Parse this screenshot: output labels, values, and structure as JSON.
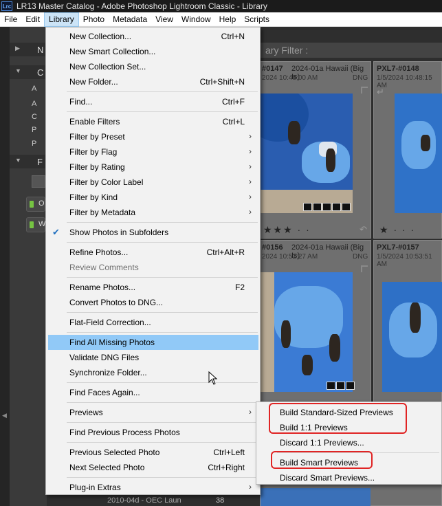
{
  "window": {
    "app_icon": "Lrc",
    "title": "LR13 Master Catalog - Adobe Photoshop Lightroom Classic - Library"
  },
  "menubar": [
    "File",
    "Edit",
    "Library",
    "Photo",
    "Metadata",
    "View",
    "Window",
    "Help",
    "Scripts"
  ],
  "active_menu": "Library",
  "left_panel": {
    "rows": [
      {
        "letter": "N",
        "expanded": false
      },
      {
        "letter": "C",
        "expanded": true
      },
      {
        "letter": "F",
        "expanded": true
      }
    ],
    "collection_letters": [
      "A",
      "A",
      "C",
      "P",
      "P"
    ],
    "buttons": [
      "O",
      "W"
    ]
  },
  "filter_bar": {
    "label": "ary Filter :"
  },
  "grid": [
    {
      "num": "#0147",
      "info": "2024-01a Hawaii (Big Is)",
      "date": "2024 10:48:00 AM",
      "type": "DNG",
      "stars": "★★★ · ·"
    },
    {
      "num": "PXL7-#0148",
      "info": "PXL7-#0148",
      "date": "1/5/2024 10:48:15 AM",
      "type": "",
      "stars": "★ · · ·"
    },
    {
      "num": "#0156",
      "info": "2024-01a Hawaii (Big Is)",
      "date": "2024 10:52:27 AM",
      "type": "DNG",
      "stars": ""
    },
    {
      "num": "PXL7-#0157",
      "info": "PXL7-#0157",
      "date": "1/5/2024 10:53:51 AM",
      "type": "",
      "stars": ""
    }
  ],
  "folder_row": {
    "name": "2010-04d - OEC Laun",
    "count": "38"
  },
  "library_menu": [
    {
      "label": "New Collection...",
      "shortcut": "Ctrl+N"
    },
    {
      "label": "New Smart Collection..."
    },
    {
      "label": "New Collection Set..."
    },
    {
      "label": "New Folder...",
      "shortcut": "Ctrl+Shift+N"
    },
    {
      "label": "Find...",
      "shortcut": "Ctrl+F"
    },
    {
      "label": "Enable Filters",
      "shortcut": "Ctrl+L"
    },
    {
      "label": "Filter by Preset",
      "submenu": true
    },
    {
      "label": "Filter by Flag",
      "submenu": true
    },
    {
      "label": "Filter by Rating",
      "submenu": true
    },
    {
      "label": "Filter by Color Label",
      "submenu": true
    },
    {
      "label": "Filter by Kind",
      "submenu": true
    },
    {
      "label": "Filter by Metadata",
      "submenu": true
    },
    {
      "label": "Show Photos in Subfolders",
      "checked": true
    },
    {
      "label": "Refine Photos...",
      "shortcut": "Ctrl+Alt+R"
    },
    {
      "label": "Review Comments",
      "disabled": true
    },
    {
      "label": "Rename Photos...",
      "shortcut": "F2"
    },
    {
      "label": "Convert Photos to DNG..."
    },
    {
      "label": "Flat-Field Correction..."
    },
    {
      "label": "Find All Missing Photos",
      "highlighted": true
    },
    {
      "label": "Validate DNG Files"
    },
    {
      "label": "Synchronize Folder..."
    },
    {
      "label": "Find Faces Again..."
    },
    {
      "label": "Previews",
      "submenu": true
    },
    {
      "label": "Find Previous Process Photos"
    },
    {
      "label": "Previous Selected Photo",
      "shortcut": "Ctrl+Left"
    },
    {
      "label": "Next Selected Photo",
      "shortcut": "Ctrl+Right"
    },
    {
      "label": "Plug-in Extras",
      "submenu": true
    }
  ],
  "previews_submenu": [
    {
      "label": "Build Standard-Sized Previews",
      "annotated": true
    },
    {
      "label": "Build 1:1 Previews",
      "annotated": true
    },
    {
      "label": "Discard 1:1 Previews..."
    },
    {
      "label": "Build Smart Previews",
      "annotated": true
    },
    {
      "label": "Discard Smart Previews..."
    }
  ],
  "colors": {
    "menu_highlight": "#91c9f7",
    "annotation_red": "#e02424",
    "check_blue": "#1f6fbf"
  }
}
